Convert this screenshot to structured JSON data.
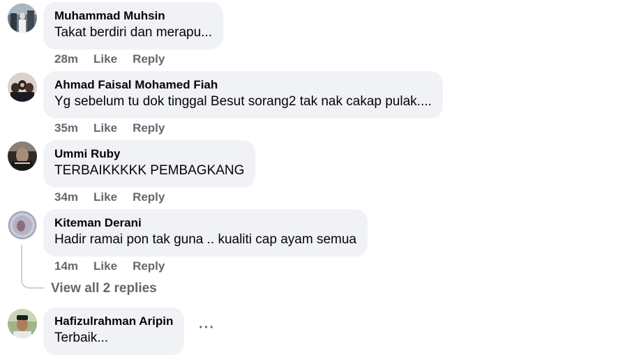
{
  "comments": [
    {
      "author": "Muhammad Muhsin",
      "text": "Takat berdiri dan merapu...",
      "time": "28m",
      "like": "Like",
      "reply": "Reply"
    },
    {
      "author": "Ahmad Faisal Mohamed Fiah",
      "text": "Yg sebelum tu dok tinggal Besut sorang2 tak nak cakap pulak....",
      "time": "35m",
      "like": "Like",
      "reply": "Reply"
    },
    {
      "author": "Ummi Ruby",
      "text": "TERBAIKKKKK PEMBAGKANG",
      "time": "34m",
      "like": "Like",
      "reply": "Reply"
    },
    {
      "author": "Kiteman Derani",
      "text": "Hadir ramai pon tak guna .. kualiti cap ayam semua",
      "time": "14m",
      "like": "Like",
      "reply": "Reply"
    },
    {
      "author": "Hafizulrahman Aripin",
      "text": "Terbaik..."
    }
  ],
  "view_replies": "View all 2 replies",
  "more_options": "···",
  "colors": {
    "bubble": "#f0f2f5",
    "secondary_text": "#65676b",
    "primary_text": "#050505"
  }
}
